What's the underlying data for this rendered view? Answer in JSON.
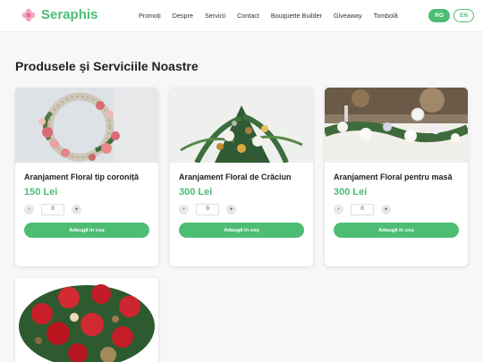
{
  "header": {
    "brand": "Seraphis",
    "nav": [
      "Promoți",
      "Despre",
      "Servicii",
      "Contact",
      "Bouquette Builder",
      "Giveaway",
      "Tombolă"
    ],
    "lang_ro": "RO",
    "lang_en": "EN"
  },
  "main": {
    "title": "Produsele și Serviciile Noastre",
    "products": [
      {
        "title": "Aranjament Floral tip coroniță",
        "price": "150 Lei",
        "qty": "0",
        "minus": "-",
        "plus": "+",
        "add": "Adaugă în coș"
      },
      {
        "title": "Aranjament Floral de Crăciun",
        "price": "300 Lei",
        "qty": "0",
        "minus": "-",
        "plus": "+",
        "add": "Adaugă în coș"
      },
      {
        "title": "Aranjament Floral pentru masă",
        "price": "300 Lei",
        "qty": "0",
        "minus": "-",
        "plus": "+",
        "add": "Adaugă în coș"
      }
    ]
  },
  "colors": {
    "accent": "#4dbd74",
    "background": "#f7f7f7"
  }
}
